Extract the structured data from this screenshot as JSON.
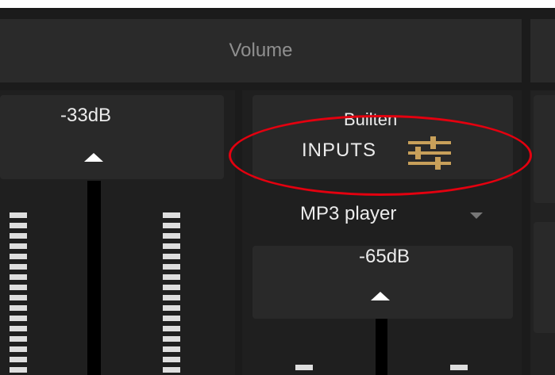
{
  "header": {
    "title": "Volume"
  },
  "channel_left": {
    "level": "-33dB"
  },
  "channel_mid": {
    "title": "Builten",
    "inputs_label": "INPUTS",
    "inputs_icon": "sliders-icon",
    "source": "MP3 player",
    "level": "-65dB"
  },
  "colors": {
    "background": "#1b1b1b",
    "panel": "#292929",
    "text": "#ececec",
    "icon_accent": "#c8a05a",
    "highlight": "#e3000f"
  }
}
